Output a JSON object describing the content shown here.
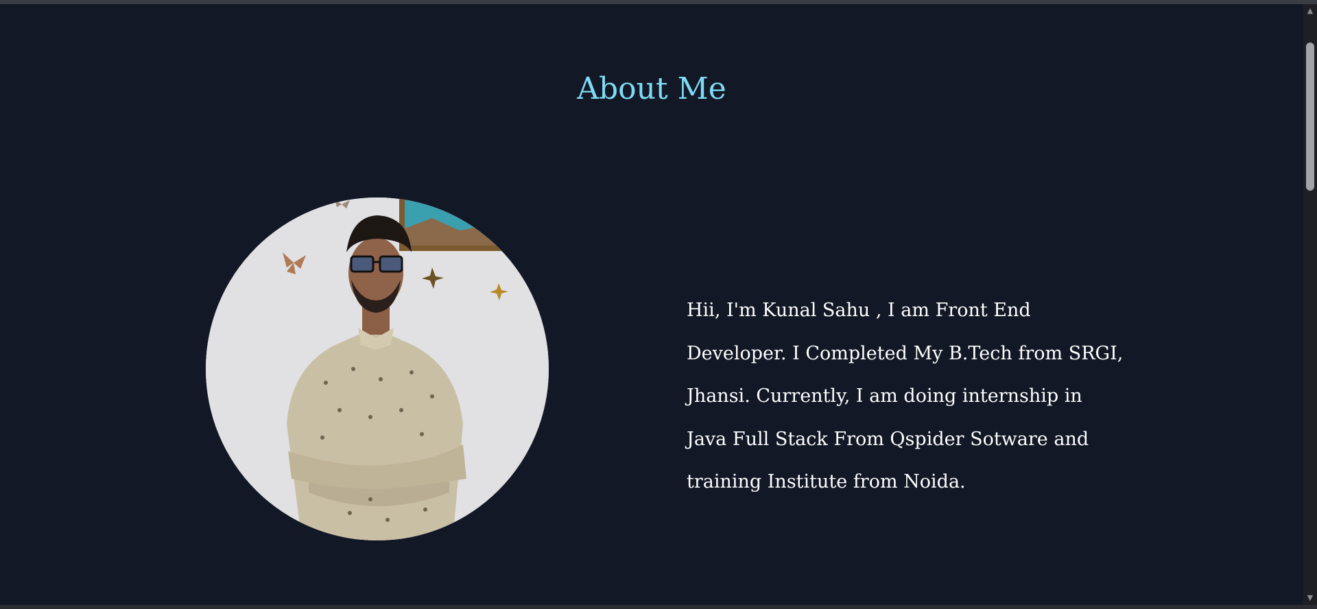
{
  "about": {
    "title": "About Me",
    "photo_alt": "Kunal Sahu profile photo",
    "description": "Hii, I'm Kunal Sahu , I am Front End Developer. I Completed My B.Tech from SRGI, Jhansi. Currently, I am doing internship in Java Full Stack From Qspider Sotware and training Institute from Noida."
  },
  "icons": {
    "scroll_up": "chevron-up-icon",
    "scroll_down": "chevron-down-icon"
  },
  "colors": {
    "background": "#131826",
    "title": "#7fdbf5",
    "text": "#ffffff"
  }
}
